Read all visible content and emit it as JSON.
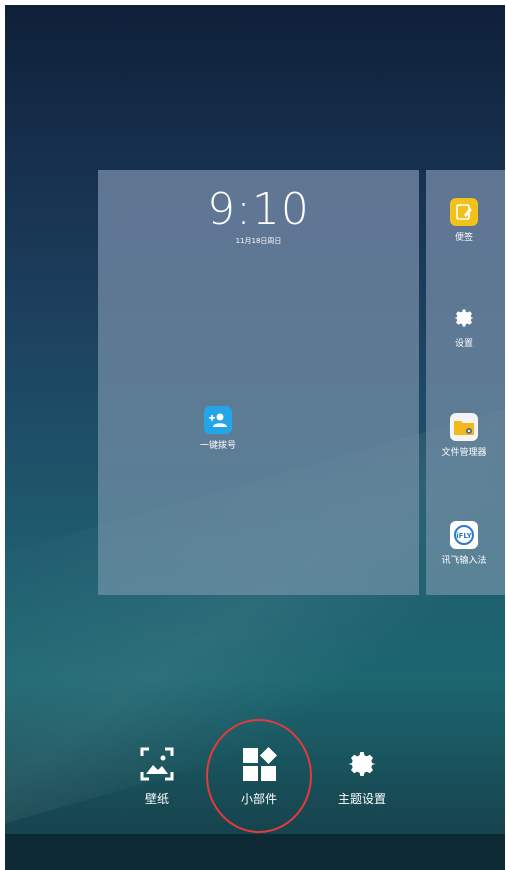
{
  "home": {
    "clock": {
      "time": "9:10",
      "date": "11月18日周日"
    },
    "left_page": {
      "apps": [
        {
          "label": "一键拨号",
          "icon": "add-contact-icon"
        }
      ]
    },
    "right_page": {
      "apps": [
        {
          "label": "便签",
          "icon": "notes-icon"
        },
        {
          "label": "设置",
          "icon": "gear-icon"
        },
        {
          "label": "文件管理器",
          "icon": "folder-icon"
        },
        {
          "label": "讯飞输入法",
          "icon": "ifly-icon"
        }
      ]
    }
  },
  "edit_bar": {
    "items": [
      {
        "label": "壁纸",
        "icon": "wallpaper-icon"
      },
      {
        "label": "小部件",
        "icon": "widgets-icon"
      },
      {
        "label": "主题设置",
        "icon": "gear-icon"
      }
    ]
  },
  "colors": {
    "highlight": "#e53a3a",
    "dial_icon": "#23a6e8",
    "notes_icon": "#f2c21c"
  }
}
